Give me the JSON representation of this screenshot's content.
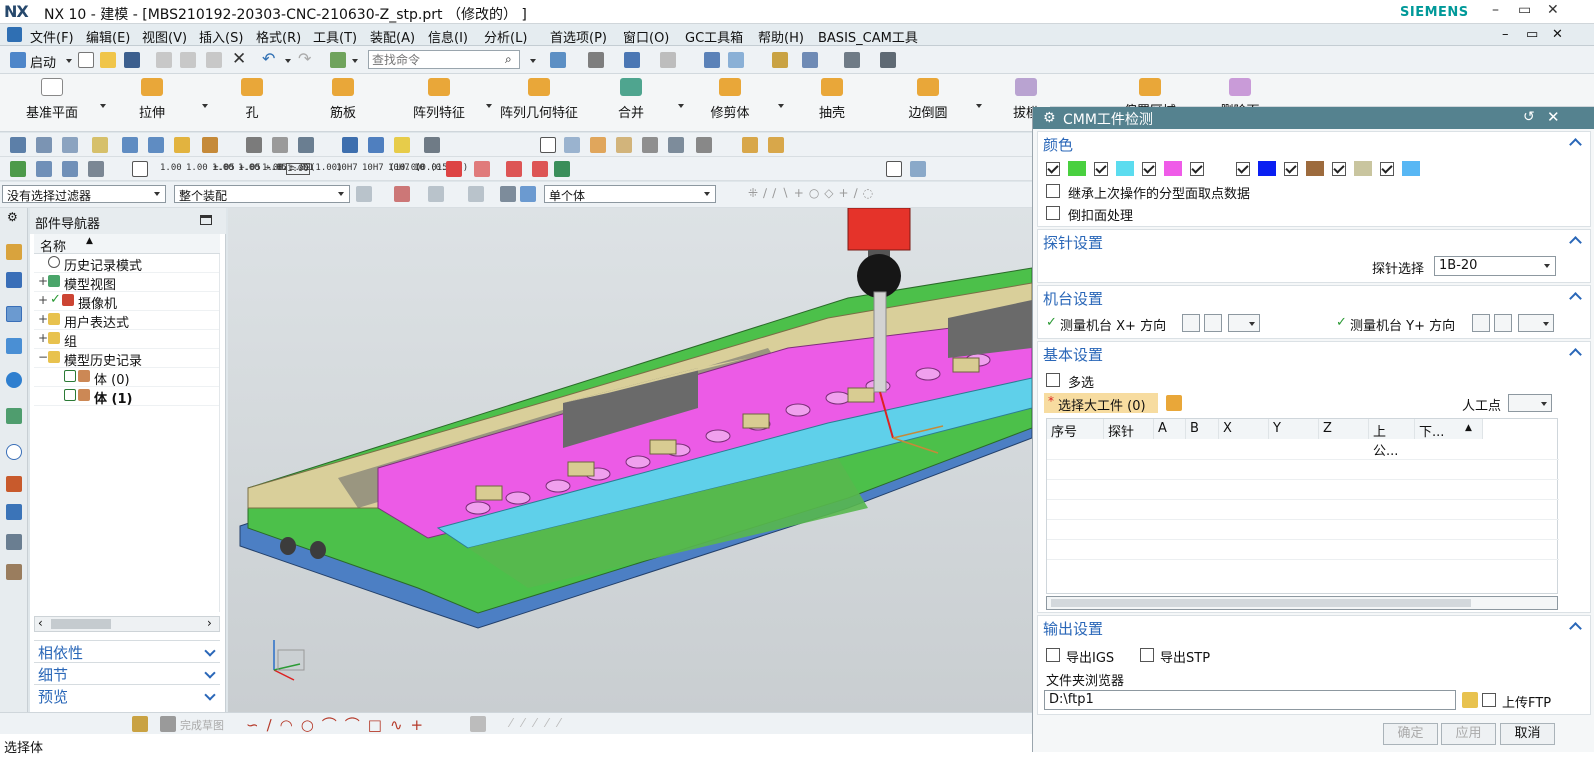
{
  "window": {
    "logo": "NX",
    "title": "NX 10 - 建模 - [MBS210192-20303-CNC-210630-Z_stp.prt （修改的） ]",
    "brand": "SIEMENS",
    "controls": [
      "–",
      "▭",
      "✕"
    ]
  },
  "menu": {
    "items": [
      "文件(F)",
      "编辑(E)",
      "视图(V)",
      "插入(S)",
      "格式(R)",
      "工具(T)",
      "装配(A)",
      "信息(I)",
      "分析(L)",
      "首选项(P)",
      "窗口(O)",
      "GC工具箱",
      "帮助(H)",
      "BASIS_CAM工具"
    ]
  },
  "quickbar": {
    "start_label": "启动",
    "find_placeholder": "查找命令"
  },
  "ribbon": {
    "buttons": [
      "基准平面",
      "拉伸",
      "孔",
      "筋板",
      "阵列特征",
      "阵列几何特征",
      "合并",
      "修剪体",
      "抽壳",
      "边倒圆",
      "拔模",
      "偏置区域",
      "删除面"
    ]
  },
  "toolbar3": {
    "tolerances": [
      "1.00",
      "1.00 ±.05",
      "1.00 +.05 -.02",
      "1.00 +.05 -.01",
      "1.00 ±.02",
      "1.00",
      "(1.00)",
      "10H7",
      "10H7 (10.0)",
      "10H7 (0.015)",
      "10 (0.015)"
    ]
  },
  "filterbar": {
    "filter": "没有选择过滤器",
    "scope": "整个装配",
    "body": "单个体"
  },
  "navigator": {
    "title": "部件导航器",
    "column": "名称",
    "rows": [
      {
        "label": "历史记录模式"
      },
      {
        "label": "模型视图"
      },
      {
        "label": "摄像机"
      },
      {
        "label": "用户表达式"
      },
      {
        "label": "组"
      },
      {
        "label": "模型历史记录"
      },
      {
        "label": "体 (0)"
      },
      {
        "label": "体 (1)"
      }
    ],
    "sections": [
      "相依性",
      "细节",
      "预览"
    ]
  },
  "dialog": {
    "title": "CMM工件检测",
    "color_group": {
      "title": "颜色",
      "swatches": [
        "#49d03f",
        "#5bdcef",
        "#ef5be8",
        "#ffffff",
        "#0a1ff2",
        "#9d6b3d",
        "#c9c59f",
        "#58b7f4"
      ],
      "opt_inherit": "继承上次操作的分型面取点数据",
      "opt_undercut": "倒扣面处理"
    },
    "probe_group": {
      "title": "探针设置",
      "label": "探针选择",
      "value": "1B-20"
    },
    "machine_group": {
      "title": "机台设置",
      "x_label": "测量机台 X+ 方向",
      "y_label": "测量机台 Y+ 方向"
    },
    "basic_group": {
      "title": "基本设置",
      "multi": "多选",
      "select_label": "选择大工件 (0)",
      "manual_point": "人工点",
      "columns": [
        "序号",
        "探针",
        "A",
        "B",
        "X",
        "Y",
        "Z",
        "上公...",
        "下..."
      ]
    },
    "output_group": {
      "title": "输出设置",
      "export_igs": "导出IGS",
      "export_stp": "导出STP",
      "folder_label": "文件夹浏览器",
      "folder_value": "D:\\ftp1",
      "upload_ftp": "上传FTP"
    },
    "buttons": {
      "ok": "确定",
      "apply": "应用",
      "cancel": "取消"
    }
  },
  "sketch": {
    "label": "完成草图"
  },
  "status": {
    "text": "选择体"
  }
}
